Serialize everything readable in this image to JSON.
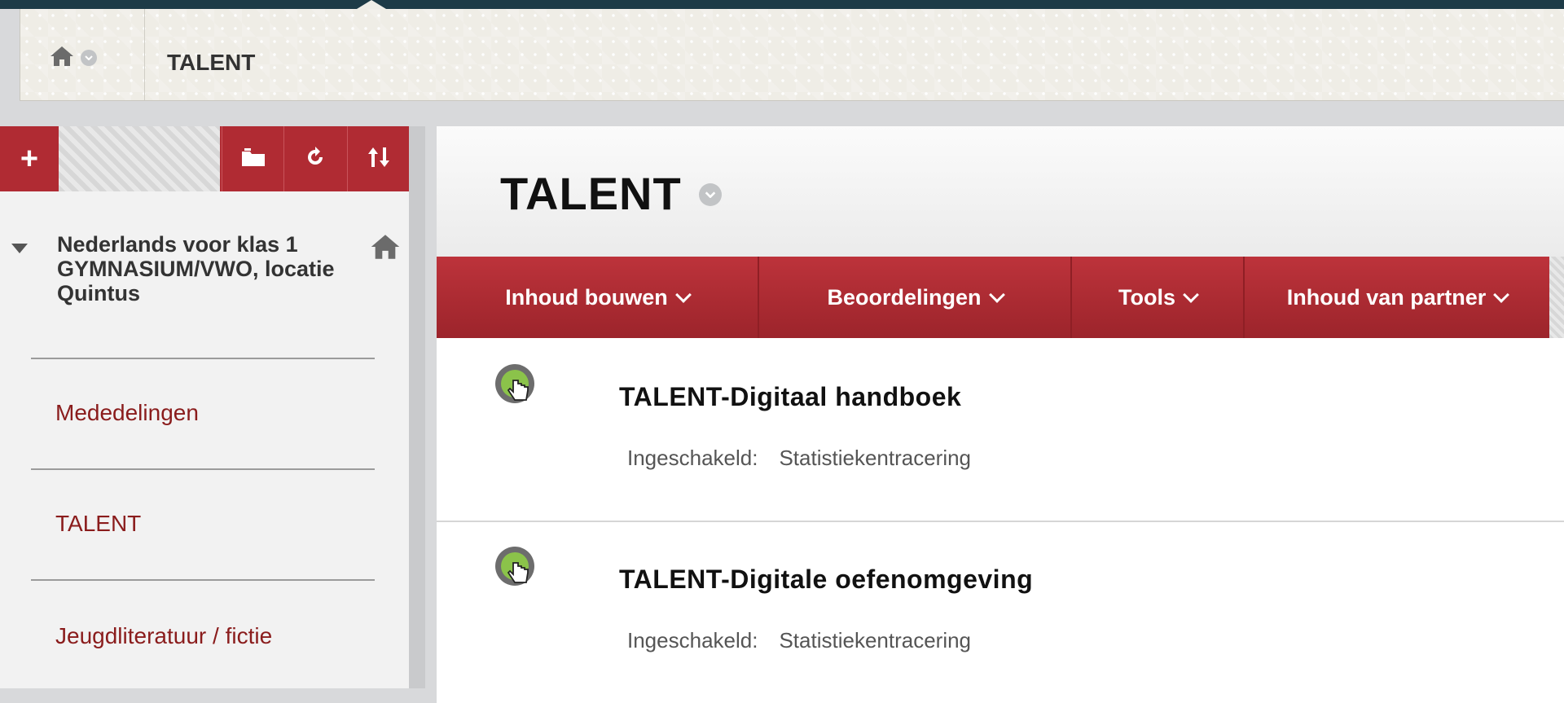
{
  "breadcrumb": {
    "current": "TALENT"
  },
  "sidebar": {
    "toolbar": {
      "add_label": "+"
    },
    "course_title": "Nederlands voor klas 1 GYMNASIUM/VWO, locatie Quintus",
    "items": [
      {
        "label": "Mededelingen"
      },
      {
        "label": "TALENT"
      },
      {
        "label": "Jeugdliteratuur / fictie"
      }
    ]
  },
  "main": {
    "title": "TALENT",
    "actions": [
      {
        "label": "Inhoud bouwen"
      },
      {
        "label": "Beoordelingen"
      },
      {
        "label": "Tools"
      },
      {
        "label": "Inhoud van partner"
      }
    ],
    "content_items": [
      {
        "title": "TALENT-Digitaal handboek",
        "meta_label": "Ingeschakeld:",
        "meta_value": "Statistiekentracering"
      },
      {
        "title": "TALENT-Digitale oefenomgeving",
        "meta_label": "Ingeschakeld:",
        "meta_value": "Statistiekentracering"
      }
    ]
  },
  "colors": {
    "accent_red": "#b02b33",
    "link_red": "#8a1c1c",
    "icon_green": "#8bc34a"
  },
  "icons": [
    "home-icon",
    "chevron-down-icon",
    "folder-icon",
    "refresh-icon",
    "sort-icon",
    "link-hand-icon"
  ]
}
